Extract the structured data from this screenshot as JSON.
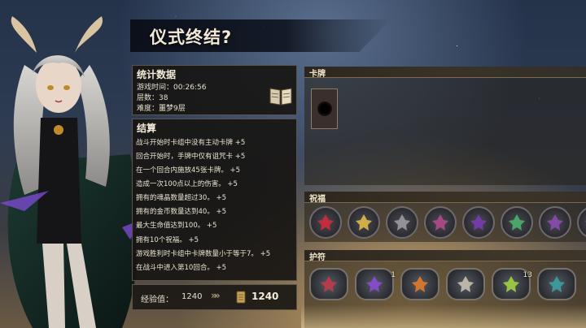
{
  "title": "仪式终结?",
  "stats": {
    "heading": "统计数据",
    "play_time": "游戏时间：00:26:56",
    "floors": "层数：38",
    "difficulty": "难度：噩梦9层"
  },
  "results": {
    "heading": "结算",
    "lines": [
      "战斗开始时卡组中没有主动卡牌 +5",
      "回合开始时，手牌中仅有诅咒卡 +5",
      "在一个回合内施放45张卡牌。 +5",
      "造成一次100点以上的伤害。 +5",
      "拥有的魂晶数量超过30。 +5",
      "拥有的金币数量达到40。 +5",
      "最大生命值达到100。 +5",
      "拥有10个祝福。 +5",
      "游戏胜利时卡组中卡牌数量小于等于7。 +5",
      "在战斗中进入第10回合。 +5"
    ]
  },
  "experience": {
    "label": "经验值：",
    "value": "1240",
    "arrows": "»»",
    "total": "1240"
  },
  "sections": {
    "cards": "卡牌",
    "blessings": "祝福",
    "charms": "护符"
  },
  "blessings": [
    {
      "icon": "heart-icon",
      "color": "#d12a3a"
    },
    {
      "icon": "spark-wing-icon",
      "color": "#e0b84a"
    },
    {
      "icon": "stone-fist-icon",
      "color": "#9a9aa0"
    },
    {
      "icon": "rune-sigil-icon",
      "color": "#b04a8a"
    },
    {
      "icon": "shadow-crystal-icon",
      "color": "#7a3ab0"
    },
    {
      "icon": "green-swirl-icon",
      "color": "#4ab070"
    },
    {
      "icon": "eye-rune-icon",
      "color": "#8a4ab0"
    },
    {
      "icon": "ring-icon",
      "color": "#c04ad0"
    }
  ],
  "charms": [
    {
      "icon": "orb-amulet-icon",
      "color": "#c03a4a",
      "count": ""
    },
    {
      "icon": "purple-gem-icon",
      "color": "#8a4ad0",
      "count": "1"
    },
    {
      "icon": "fire-mask-icon",
      "color": "#e07a2a",
      "count": ""
    },
    {
      "icon": "bone-shard-icon",
      "color": "#c8c0b0",
      "count": ""
    },
    {
      "icon": "green-potion-icon",
      "color": "#a0d040",
      "count": "13"
    },
    {
      "icon": "serpent-icon",
      "color": "#3aa0a0",
      "count": ""
    }
  ]
}
